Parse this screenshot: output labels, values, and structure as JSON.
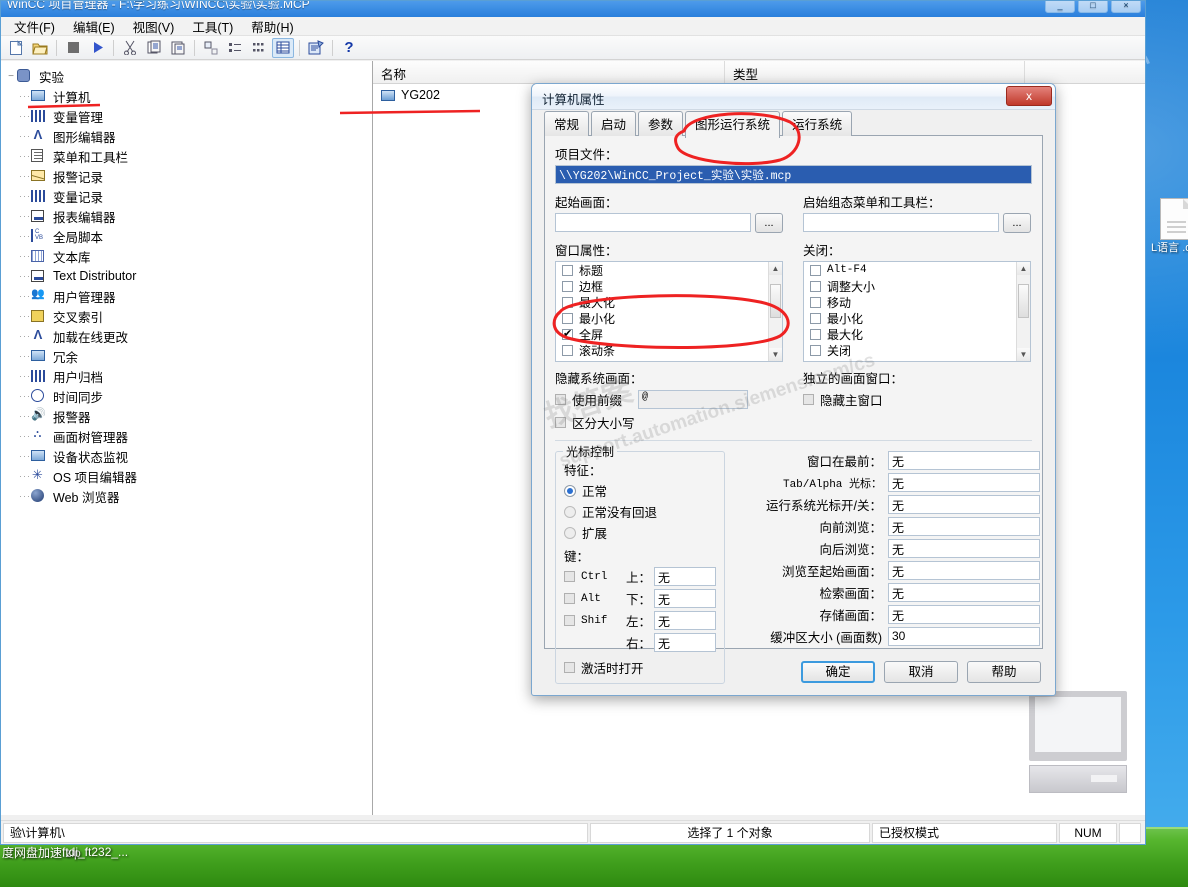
{
  "window": {
    "title": "WinCC 项目管理器 - F:\\学习练习\\WINCC\\实验\\实验.MCP",
    "minimize": "_",
    "maximize": "□",
    "close": "×"
  },
  "menu": [
    {
      "label": "文件(F)"
    },
    {
      "label": "编辑(E)"
    },
    {
      "label": "视图(V)"
    },
    {
      "label": "工具(T)"
    },
    {
      "label": "帮助(H)"
    }
  ],
  "toolbar": [
    {
      "name": "new-icon",
      "glyph": "🗋"
    },
    {
      "name": "open-icon",
      "glyph": "📂"
    },
    {
      "name": "stop-icon",
      "glyph": "■"
    },
    {
      "name": "activate-icon",
      "glyph": "▶"
    },
    {
      "name": "cut-icon",
      "glyph": "✂"
    },
    {
      "name": "copy-icon",
      "glyph": "⧉"
    },
    {
      "name": "paste-icon",
      "glyph": "📋"
    },
    {
      "name": "large-icons-icon",
      "glyph": "⬚"
    },
    {
      "name": "small-icons-icon",
      "glyph": "⋮⋮"
    },
    {
      "name": "list-icon",
      "glyph": "☷"
    },
    {
      "name": "details-icon",
      "glyph": "▦"
    },
    {
      "name": "properties-icon",
      "glyph": "🗒"
    },
    {
      "name": "help-icon",
      "glyph": "?"
    }
  ],
  "tree": {
    "root": {
      "label": "实验",
      "expander": "−",
      "icon": "gear-icon"
    },
    "items": [
      {
        "label": "计算机",
        "icon": "computer-icon"
      },
      {
        "label": "变量管理",
        "icon": "tag-management-icon"
      },
      {
        "label": "图形编辑器",
        "icon": "graphics-designer-icon"
      },
      {
        "label": "菜单和工具栏",
        "icon": "menu-toolbar-icon"
      },
      {
        "label": "报警记录",
        "icon": "alarm-logging-icon"
      },
      {
        "label": "变量记录",
        "icon": "tag-logging-icon"
      },
      {
        "label": "报表编辑器",
        "icon": "report-designer-icon"
      },
      {
        "label": "全局脚本",
        "icon": "global-script-icon"
      },
      {
        "label": "文本库",
        "icon": "text-library-icon"
      },
      {
        "label": "Text Distributor",
        "icon": "text-distributor-icon"
      },
      {
        "label": "用户管理器",
        "icon": "user-administrator-icon"
      },
      {
        "label": "交叉索引",
        "icon": "cross-reference-icon"
      },
      {
        "label": "加载在线更改",
        "icon": "load-online-changes-icon"
      },
      {
        "label": "冗余",
        "icon": "redundancy-icon"
      },
      {
        "label": "用户归档",
        "icon": "user-archive-icon"
      },
      {
        "label": "时间同步",
        "icon": "time-synchronization-icon"
      },
      {
        "label": "报警器",
        "icon": "horn-icon"
      },
      {
        "label": "画面树管理器",
        "icon": "picture-tree-icon"
      },
      {
        "label": "设备状态监视",
        "icon": "device-status-icon"
      },
      {
        "label": "OS 项目编辑器",
        "icon": "os-project-editor-icon"
      },
      {
        "label": "Web 浏览器",
        "icon": "web-navigator-icon"
      }
    ]
  },
  "list": {
    "columns": [
      {
        "label": "名称"
      },
      {
        "label": "类型"
      }
    ],
    "rows": [
      {
        "name": "YG202",
        "type": ""
      }
    ]
  },
  "statusbar": {
    "path": "验\\计算机\\",
    "selection": "选择了 1 个对象",
    "license": "已授权模式",
    "num": "NUM"
  },
  "dialog": {
    "title": "计算机属性",
    "close_label": "x",
    "tabs": [
      {
        "label": "常规",
        "selected": false
      },
      {
        "label": "启动",
        "selected": false
      },
      {
        "label": "参数",
        "selected": false
      },
      {
        "label": "图形运行系统",
        "selected": true
      },
      {
        "label": "运行系统",
        "selected": false
      }
    ],
    "project_file": {
      "label": "项目文件：",
      "value": "\\\\YG202\\WinCC_Project_实验\\实验.mcp"
    },
    "start_picture": {
      "label": "起始画面：",
      "value": "",
      "browse": "..."
    },
    "start_menu_toolbar": {
      "label": "启始组态菜单和工具栏：",
      "value": "",
      "browse": "..."
    },
    "window_attributes": {
      "label": "窗口属性：",
      "items": [
        {
          "label": "标题",
          "checked": false
        },
        {
          "label": "边框",
          "checked": false
        },
        {
          "label": "最大化",
          "checked": false
        },
        {
          "label": "最小化",
          "checked": false
        },
        {
          "label": "全屏",
          "checked": true
        },
        {
          "label": "滚动条",
          "checked": false
        }
      ]
    },
    "close_options": {
      "label": "关闭：",
      "items": [
        {
          "label": "Alt-F4",
          "checked": false
        },
        {
          "label": "调整大小",
          "checked": false
        },
        {
          "label": "移动",
          "checked": false
        },
        {
          "label": "最小化",
          "checked": false
        },
        {
          "label": "最大化",
          "checked": false
        },
        {
          "label": "关闭",
          "checked": false
        }
      ]
    },
    "hide_system_picture": {
      "label": "隐藏系统画面：",
      "use_prefix": {
        "label": "使用前缀",
        "checked": false
      },
      "prefix_value": "@",
      "case_sensitive": {
        "label": "区分大小写",
        "checked": false
      }
    },
    "independent_picture_window": {
      "label": "独立的画面窗口：",
      "hide_main_window": {
        "label": "隐藏主窗口",
        "checked": false
      }
    },
    "cursor_control": {
      "title": "光标控制",
      "feature_label": "特征：",
      "features": [
        {
          "label": "正常",
          "selected": true
        },
        {
          "label": "正常没有回退",
          "selected": false
        },
        {
          "label": "扩展",
          "selected": false
        }
      ],
      "keys_label": "键：",
      "modifiers": [
        {
          "label": "Ctrl",
          "checked": false
        },
        {
          "label": "Alt",
          "checked": false
        },
        {
          "label": "Shif",
          "checked": false
        }
      ],
      "directions": [
        {
          "label": "上：",
          "value": "无"
        },
        {
          "label": "下：",
          "value": "无"
        },
        {
          "label": "左：",
          "value": "无"
        },
        {
          "label": "右：",
          "value": "无"
        }
      ],
      "open_on_activate": {
        "label": "激活时打开",
        "checked": false
      }
    },
    "hotkeys": [
      {
        "label": "窗口在最前：",
        "value": "无"
      },
      {
        "label": "Tab/Alpha 光标：",
        "value": "无"
      },
      {
        "label": "运行系统光标开/关：",
        "value": "无"
      },
      {
        "label": "向前浏览：",
        "value": "无"
      },
      {
        "label": "向后浏览：",
        "value": "无"
      },
      {
        "label": "浏览至起始画面：",
        "value": "无"
      },
      {
        "label": "检索画面：",
        "value": "无"
      },
      {
        "label": "存储画面：",
        "value": "无"
      },
      {
        "label": "缓冲区大小 (画面数)",
        "value": "30"
      }
    ],
    "buttons": [
      {
        "label": "确定",
        "default": true
      },
      {
        "label": "取消",
        "default": false
      },
      {
        "label": "帮助",
        "default": false
      }
    ]
  },
  "watermark": {
    "line1": "找答案",
    "line2": "support.automation.siemens.com/cs"
  },
  "desktop": {
    "icons": [
      {
        "label": "L语言\n.doc",
        "name": "desktop-doc-icon"
      }
    ],
    "files": [
      {
        "label": "度网盘加速.zip"
      },
      {
        "label": "ftdi_ft232_..."
      }
    ]
  },
  "colors": {
    "accent": "#2a5db0",
    "annotation": "#ee2222",
    "titlebar": "#2a7fdc",
    "grass": "#57b62f"
  }
}
